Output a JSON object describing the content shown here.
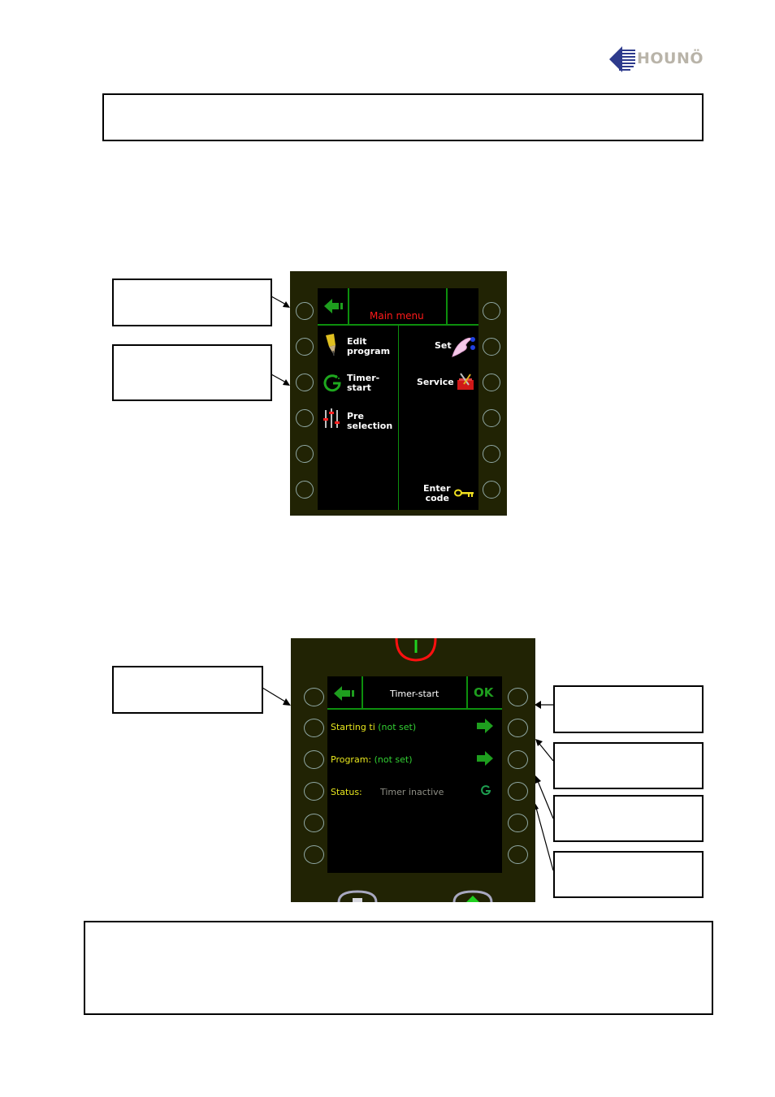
{
  "logo": {
    "text": "HOUNÖ",
    "brand_color": "#2d3a8c",
    "text_color": "#b9b4a9"
  },
  "main_menu": {
    "title": "Main menu",
    "back_icon": "back-arrow-icon",
    "items_left": [
      {
        "label_line1": "Edit",
        "label_line2": "program",
        "icon": "pencil-icon"
      },
      {
        "label_line1": "Timer-",
        "label_line2": "start",
        "icon": "timer-icon"
      },
      {
        "label_line1": "Pre",
        "label_line2": "selection",
        "icon": "sliders-icon"
      }
    ],
    "items_right": [
      {
        "label_line1": "Set",
        "label_line2": "",
        "icon": "hand-icon"
      },
      {
        "label_line1": "Service",
        "label_line2": "",
        "icon": "toolbox-icon"
      },
      {
        "label_line1": "Enter",
        "label_line2": "code",
        "icon": "key-icon"
      }
    ]
  },
  "timer_start": {
    "title": "Timer-start",
    "ok_label": "OK",
    "rows": [
      {
        "label": "Starting ti",
        "value": "(not set)",
        "icon": "arrow-right-icon"
      },
      {
        "label": "Program:",
        "value": "(not set)",
        "icon": "arrow-right-icon"
      },
      {
        "label": "Status:",
        "value": "Timer inactive",
        "icon": "timer-icon"
      }
    ]
  },
  "colors": {
    "panel_bg": "#212304",
    "screen_bg": "#000000",
    "divider_green": "#0d8f0d",
    "menu_title_red": "#ff1a1a",
    "label_yellow": "#e7e61d",
    "value_green": "#33d033",
    "status_gray": "#8e8e85"
  }
}
